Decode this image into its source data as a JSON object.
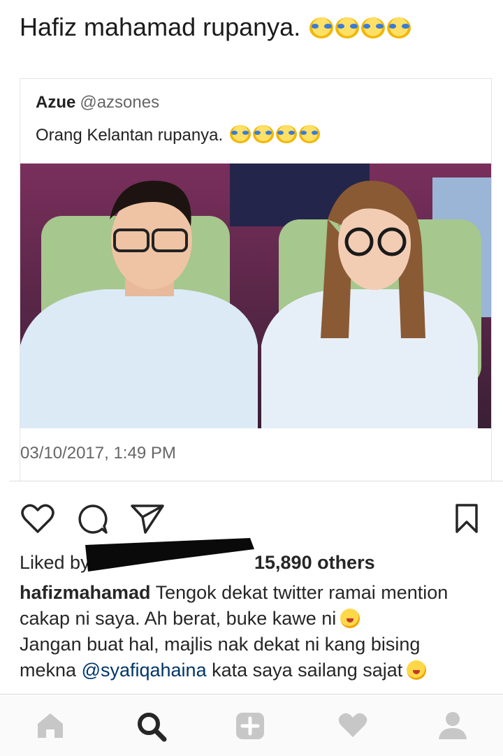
{
  "post": {
    "top_caption": "Hafiz mahamad rupanya.",
    "tweet": {
      "author": "Azue",
      "handle": "@azsones",
      "text": "Orang Kelantan rupanya.",
      "date": "03/10/2017, 1:49 PM"
    },
    "liked_prefix": "Liked by",
    "liked_count": "15,890 others",
    "caption_user": "hafizmahamad",
    "caption_text_1": "Tengok dekat twitter ramai mention cakap ni saya. Ah berat, buke kawe ni",
    "caption_text_2": "Jangan buat hal, majlis nak dekat ni kang bising mekna",
    "caption_mention": "@syafiqahaina",
    "caption_text_3": "kata saya sailang sajat"
  },
  "actions": {
    "like_icon": "heart-outline-icon",
    "comment_icon": "speech-bubble-icon",
    "share_icon": "paper-plane-icon",
    "save_icon": "bookmark-icon"
  },
  "tabbar": {
    "tabs": [
      "home-icon",
      "search-icon",
      "add-icon",
      "heart-icon",
      "profile-icon"
    ]
  },
  "colors": {
    "text": "#262626",
    "mention": "#003569",
    "tabbar_icon": "#c7c7c7",
    "tabbar_active": "#262626"
  }
}
